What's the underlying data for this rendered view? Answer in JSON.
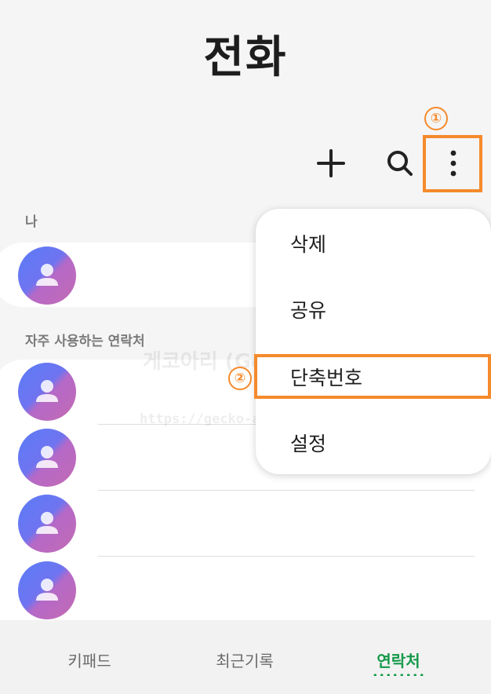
{
  "header": {
    "title": "전화"
  },
  "toolbar": {
    "add_icon": "plus-icon",
    "search_icon": "search-icon",
    "more_icon": "more-vertical-icon"
  },
  "annotations": {
    "callout_1": "①",
    "callout_2": "②",
    "accent_color": "#f58a2c"
  },
  "sections": {
    "me_label": "나",
    "frequent_label": "자주 사용하는 연락처"
  },
  "menu": {
    "items": [
      {
        "label": "삭제"
      },
      {
        "label": "공유"
      },
      {
        "label": "단축번호"
      },
      {
        "label": "설정"
      }
    ]
  },
  "watermark": {
    "line1": "게코아리 (Gecko-Ari)",
    "line2": "https://gecko-ari.tistory.com"
  },
  "bottom_nav": {
    "tabs": [
      {
        "label": "키패드"
      },
      {
        "label": "최근기록"
      },
      {
        "label": "연락처"
      }
    ],
    "active_color": "#15994a"
  }
}
